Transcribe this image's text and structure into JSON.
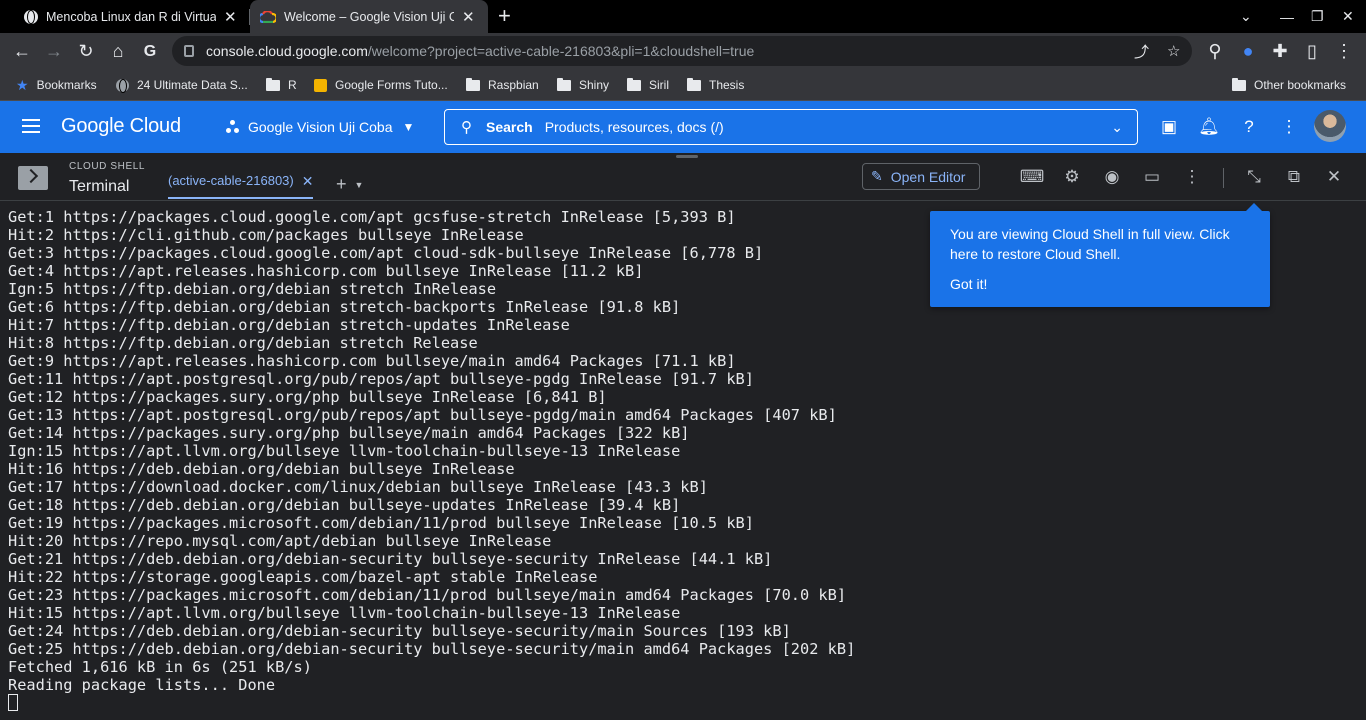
{
  "browser": {
    "tabs": [
      {
        "title": "Mencoba Linux dan R di Virtual Machine",
        "active": false
      },
      {
        "title": "Welcome – Google Vision Uji Coba",
        "active": true
      }
    ],
    "new_tab": "+",
    "url_host": "console.cloud.google.com",
    "url_path": "/welcome?project=active-cable-216803&pli=1&cloudshell=true",
    "bookmarks": [
      {
        "label": "Bookmarks",
        "icon": "star-icon"
      },
      {
        "label": "24 Ultimate Data S...",
        "icon": "site-icon"
      },
      {
        "label": "R",
        "icon": "folder-icon"
      },
      {
        "label": "Google Forms Tuto...",
        "icon": "site-icon"
      },
      {
        "label": "Raspbian",
        "icon": "folder-icon"
      },
      {
        "label": "Shiny",
        "icon": "folder-icon"
      },
      {
        "label": "Siril",
        "icon": "folder-icon"
      },
      {
        "label": "Thesis",
        "icon": "folder-icon"
      }
    ],
    "other_bookmarks": "Other bookmarks"
  },
  "gcloud": {
    "logo": "Google Cloud",
    "project": "Google Vision Uji Coba",
    "search_label": "Search",
    "search_placeholder": "Products, resources, docs (/)"
  },
  "shell": {
    "label": "CLOUD SHELL",
    "title": "Terminal",
    "tab": "(active-cable-216803)",
    "open_editor": "Open Editor"
  },
  "terminal": {
    "lines": [
      "Get:1 https://packages.cloud.google.com/apt gcsfuse-stretch InRelease [5,393 B]",
      "Hit:2 https://cli.github.com/packages bullseye InRelease",
      "Get:3 https://packages.cloud.google.com/apt cloud-sdk-bullseye InRelease [6,778 B]",
      "Get:4 https://apt.releases.hashicorp.com bullseye InRelease [11.2 kB]",
      "Ign:5 https://ftp.debian.org/debian stretch InRelease",
      "Get:6 https://ftp.debian.org/debian stretch-backports InRelease [91.8 kB]",
      "Hit:7 https://ftp.debian.org/debian stretch-updates InRelease",
      "Hit:8 https://ftp.debian.org/debian stretch Release",
      "Get:9 https://apt.releases.hashicorp.com bullseye/main amd64 Packages [71.1 kB]",
      "Get:11 https://apt.postgresql.org/pub/repos/apt bullseye-pgdg InRelease [91.7 kB]",
      "Get:12 https://packages.sury.org/php bullseye InRelease [6,841 B]",
      "Get:13 https://apt.postgresql.org/pub/repos/apt bullseye-pgdg/main amd64 Packages [407 kB]",
      "Get:14 https://packages.sury.org/php bullseye/main amd64 Packages [322 kB]",
      "Ign:15 https://apt.llvm.org/bullseye llvm-toolchain-bullseye-13 InRelease",
      "Hit:16 https://deb.debian.org/debian bullseye InRelease",
      "Get:17 https://download.docker.com/linux/debian bullseye InRelease [43.3 kB]",
      "Get:18 https://deb.debian.org/debian bullseye-updates InRelease [39.4 kB]",
      "Get:19 https://packages.microsoft.com/debian/11/prod bullseye InRelease [10.5 kB]",
      "Hit:20 https://repo.mysql.com/apt/debian bullseye InRelease",
      "Get:21 https://deb.debian.org/debian-security bullseye-security InRelease [44.1 kB]",
      "Hit:22 https://storage.googleapis.com/bazel-apt stable InRelease",
      "Get:23 https://packages.microsoft.com/debian/11/prod bullseye/main amd64 Packages [70.0 kB]",
      "Hit:15 https://apt.llvm.org/bullseye llvm-toolchain-bullseye-13 InRelease",
      "Get:24 https://deb.debian.org/debian-security bullseye-security/main Sources [193 kB]",
      "Get:25 https://deb.debian.org/debian-security bullseye-security/main amd64 Packages [202 kB]",
      "Fetched 1,616 kB in 6s (251 kB/s)",
      "Reading package lists... Done"
    ]
  },
  "tooltip": {
    "message": "You are viewing Cloud Shell in full view. Click here to restore Cloud Shell.",
    "action": "Got it!"
  },
  "colors": {
    "gcloud_blue": "#1a73e8",
    "terminal_bg": "#202124",
    "link_blue": "#8ab4f8"
  }
}
